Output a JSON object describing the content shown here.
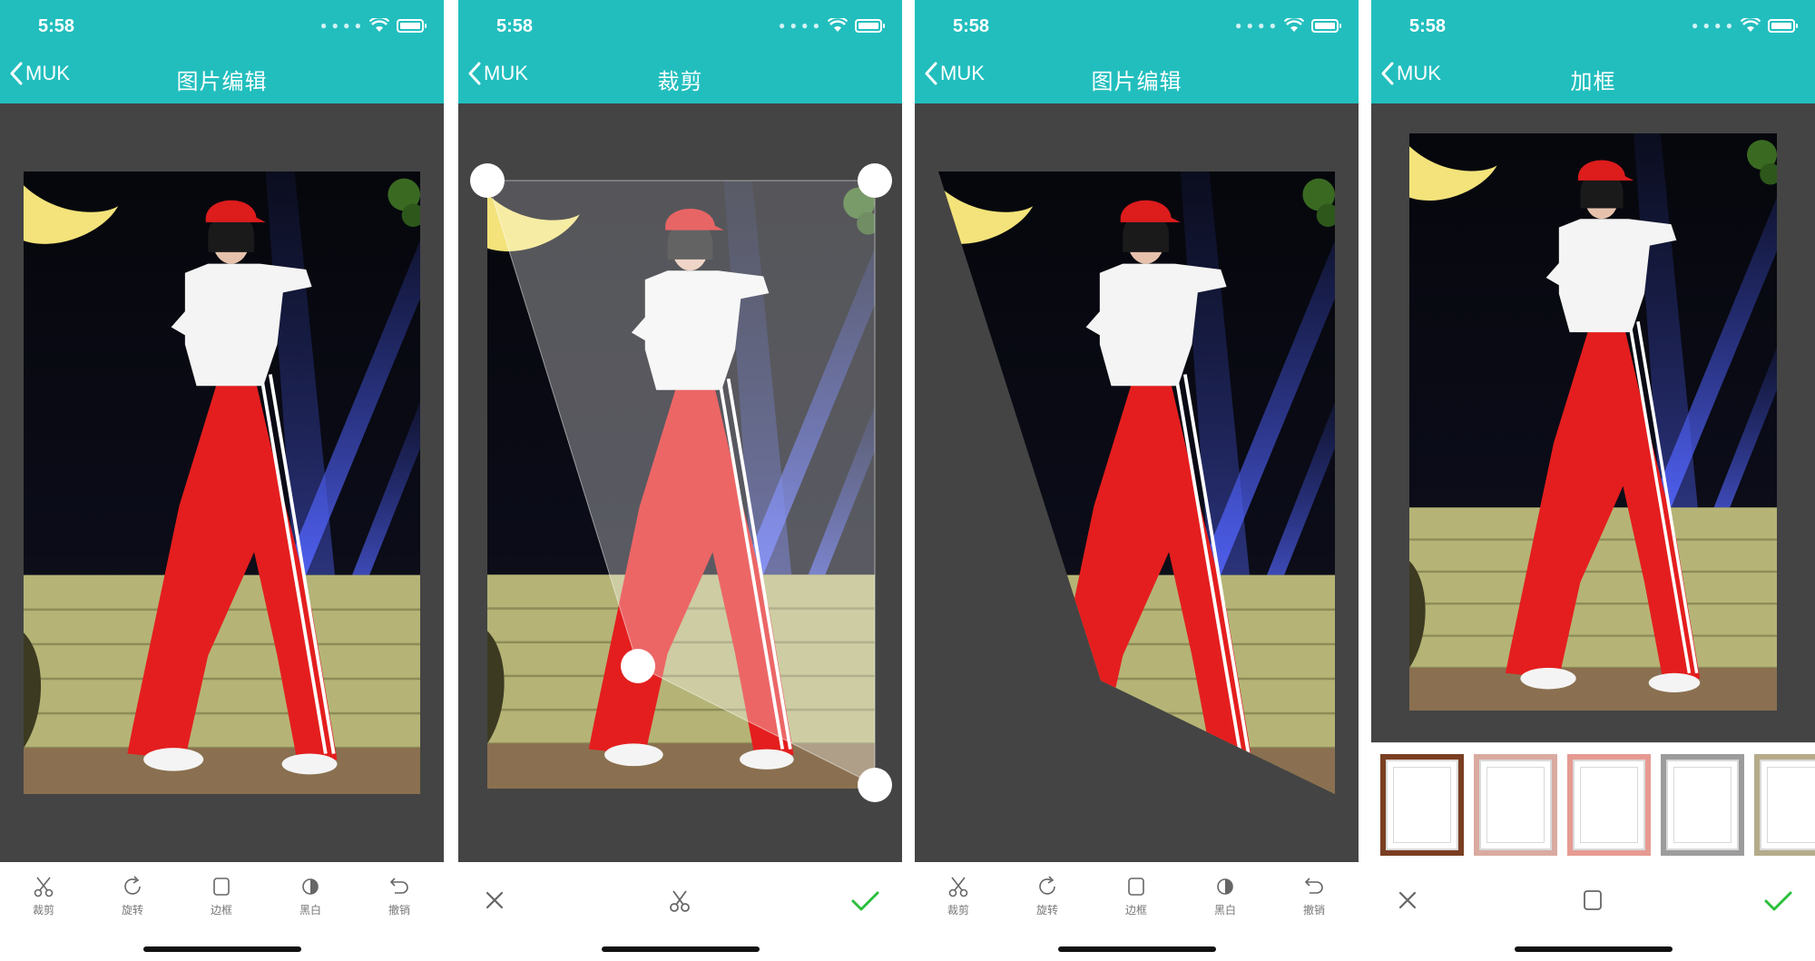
{
  "status": {
    "time": "5:58"
  },
  "nav": {
    "back_label": "MUK"
  },
  "screens": [
    {
      "title": "图片编辑"
    },
    {
      "title": "裁剪"
    },
    {
      "title": "图片编辑"
    },
    {
      "title": "加框"
    }
  ],
  "tools": [
    {
      "label": "裁剪",
      "icon": "scissors-icon"
    },
    {
      "label": "旋转",
      "icon": "rotate-icon"
    },
    {
      "label": "边框",
      "icon": "frame-icon"
    },
    {
      "label": "黑白",
      "icon": "contrast-icon"
    },
    {
      "label": "撤销",
      "icon": "undo-icon"
    }
  ],
  "frames": [
    {
      "color": "#7a3e22"
    },
    {
      "color": "#d9aaa0"
    },
    {
      "color": "#e69a92"
    },
    {
      "color": "#9c9c9c"
    },
    {
      "color": "#b5ab8a"
    }
  ],
  "colors": {
    "accent": "#22bebe",
    "confirm": "#2bbf3c",
    "canvas": "#444444"
  }
}
